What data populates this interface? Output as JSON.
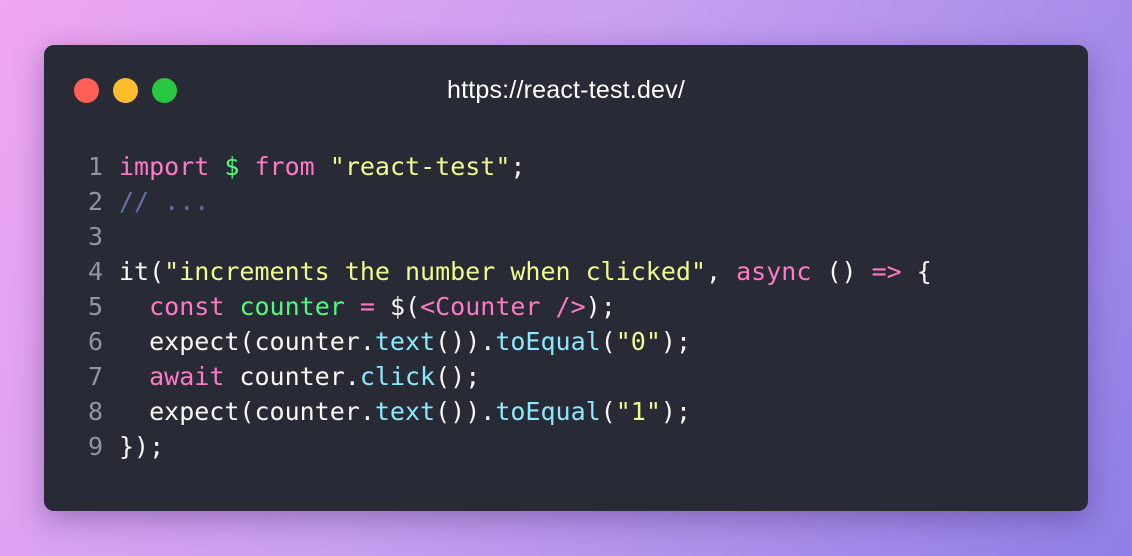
{
  "window": {
    "title": "https://react-test.dev/",
    "controls": [
      {
        "name": "close",
        "color": "#ff5f57"
      },
      {
        "name": "minimize",
        "color": "#febc2e"
      },
      {
        "name": "maximize",
        "color": "#28c840"
      }
    ]
  },
  "colors": {
    "background": "#282a36",
    "keyword": "#ff79c6",
    "string": "#f1fa8c",
    "comment": "#6272a4",
    "function": "#8be9fd",
    "variable": "#50fa7b",
    "plain": "#f8f8f2",
    "line_number": "#8f96a3"
  },
  "code": {
    "lines": [
      {
        "number": "1",
        "tokens": [
          {
            "t": "kw",
            "v": "import"
          },
          {
            "t": "pl",
            "v": " "
          },
          {
            "t": "var",
            "v": "$"
          },
          {
            "t": "pl",
            "v": " "
          },
          {
            "t": "kw",
            "v": "from"
          },
          {
            "t": "pl",
            "v": " "
          },
          {
            "t": "str",
            "v": "\"react-test\""
          },
          {
            "t": "pl",
            "v": ";"
          }
        ]
      },
      {
        "number": "2",
        "tokens": [
          {
            "t": "cmt",
            "v": "// ..."
          }
        ]
      },
      {
        "number": "3",
        "tokens": []
      },
      {
        "number": "4",
        "tokens": [
          {
            "t": "pl",
            "v": "it("
          },
          {
            "t": "str",
            "v": "\"increments the number when clicked\""
          },
          {
            "t": "pl",
            "v": ", "
          },
          {
            "t": "kw",
            "v": "async"
          },
          {
            "t": "pl",
            "v": " () "
          },
          {
            "t": "kw",
            "v": "=>"
          },
          {
            "t": "pl",
            "v": " {"
          }
        ]
      },
      {
        "number": "5",
        "tokens": [
          {
            "t": "pl",
            "v": "  "
          },
          {
            "t": "kw",
            "v": "const"
          },
          {
            "t": "pl",
            "v": " "
          },
          {
            "t": "var",
            "v": "counter"
          },
          {
            "t": "pl",
            "v": " "
          },
          {
            "t": "kw",
            "v": "="
          },
          {
            "t": "pl",
            "v": " $("
          },
          {
            "t": "kw",
            "v": "<Counter />"
          },
          {
            "t": "pl",
            "v": ");"
          }
        ]
      },
      {
        "number": "6",
        "tokens": [
          {
            "t": "pl",
            "v": "  expect(counter."
          },
          {
            "t": "fn",
            "v": "text"
          },
          {
            "t": "pl",
            "v": "())."
          },
          {
            "t": "fn",
            "v": "toEqual"
          },
          {
            "t": "pl",
            "v": "("
          },
          {
            "t": "str",
            "v": "\"0\""
          },
          {
            "t": "pl",
            "v": ");"
          }
        ]
      },
      {
        "number": "7",
        "tokens": [
          {
            "t": "pl",
            "v": "  "
          },
          {
            "t": "kw",
            "v": "await"
          },
          {
            "t": "pl",
            "v": " counter."
          },
          {
            "t": "fn",
            "v": "click"
          },
          {
            "t": "pl",
            "v": "();"
          }
        ]
      },
      {
        "number": "8",
        "tokens": [
          {
            "t": "pl",
            "v": "  expect(counter."
          },
          {
            "t": "fn",
            "v": "text"
          },
          {
            "t": "pl",
            "v": "())."
          },
          {
            "t": "fn",
            "v": "toEqual"
          },
          {
            "t": "pl",
            "v": "("
          },
          {
            "t": "str",
            "v": "\"1\""
          },
          {
            "t": "pl",
            "v": ");"
          }
        ]
      },
      {
        "number": "9",
        "tokens": [
          {
            "t": "pl",
            "v": "});"
          }
        ]
      }
    ]
  }
}
